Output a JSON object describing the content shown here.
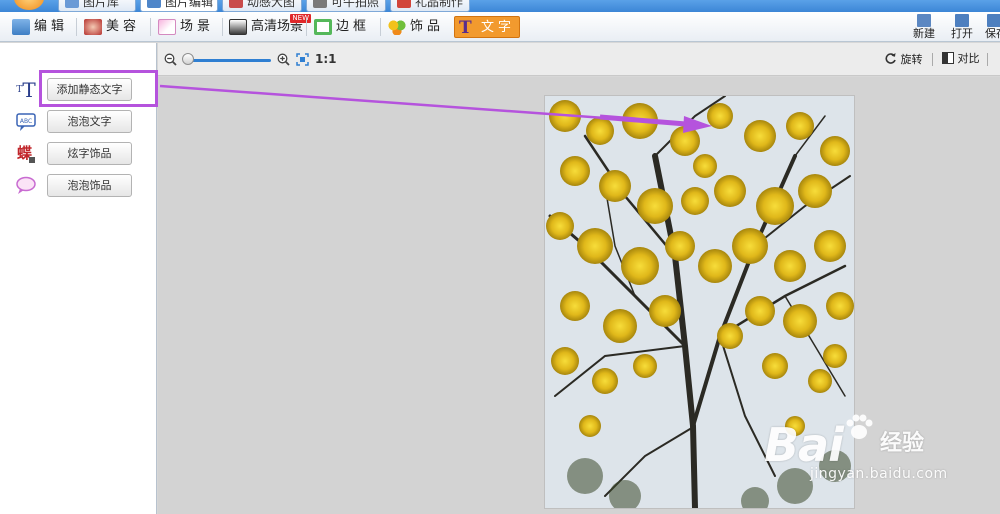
{
  "top_tabs": [
    {
      "label": "图片库",
      "icon": "picture-library-icon"
    },
    {
      "label": "图片编辑",
      "icon": "picture-edit-icon"
    },
    {
      "label": "动感大图",
      "icon": "animated-picture-icon"
    },
    {
      "label": "可牛拍照",
      "icon": "camera-icon"
    },
    {
      "label": "礼品制作",
      "icon": "gift-icon"
    }
  ],
  "toolbar": {
    "tools": [
      {
        "label": "编辑",
        "icon": "edit-icon"
      },
      {
        "label": "美容",
        "icon": "beauty-icon"
      },
      {
        "label": "场景",
        "icon": "scene-icon"
      },
      {
        "label": "高清场景",
        "icon": "hd-scene-icon",
        "badge": "NEW"
      },
      {
        "label": "边框",
        "icon": "frame-icon"
      },
      {
        "label": "饰品",
        "icon": "decoration-icon"
      },
      {
        "label": "文字",
        "icon": "text-tool-icon",
        "active": true
      }
    ],
    "right": [
      {
        "label": "新建",
        "icon": "new-file-icon"
      },
      {
        "label": "打开",
        "icon": "open-folder-icon"
      },
      {
        "label": "保存",
        "icon": "save-icon"
      }
    ]
  },
  "left_panel": {
    "items": [
      {
        "label": "添加静态文字",
        "icon": "static-text-icon"
      },
      {
        "label": "泡泡文字",
        "icon": "bubble-text-icon"
      },
      {
        "label": "炫字饰品",
        "icon": "fancy-text-icon"
      },
      {
        "label": "泡泡饰品",
        "icon": "bubble-decoration-icon"
      }
    ]
  },
  "canvas_bar": {
    "zoom_level": 0.0,
    "ratio_label": "1:1",
    "rotate_label": "旋转",
    "compare_label": "对比"
  },
  "watermark": {
    "main": "Bai",
    "cn": "经验",
    "sub": "jingyan.baidu.com"
  },
  "colors": {
    "highlight": "#b553dd",
    "active_tool": "#f29a2e",
    "slider": "#2f7fd2"
  }
}
